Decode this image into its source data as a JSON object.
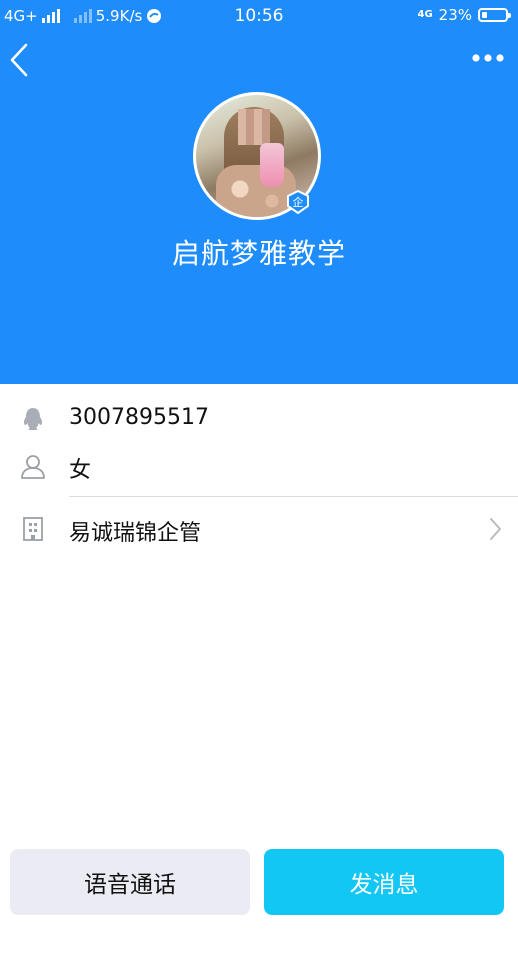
{
  "status_bar": {
    "network": "4G+",
    "speed": "5.9K/s",
    "time": "10:56",
    "network_right": "4G",
    "battery_percent_label": "23%",
    "battery_level": 0.23
  },
  "header": {
    "background_color": "#1f8cfb",
    "group_name": "启航梦雅教学",
    "badge_label": "企"
  },
  "info": {
    "qq_number": "3007895517",
    "gender": "女",
    "company": "易诚瑞锦企管"
  },
  "actions": {
    "voice_call_label": "语音通话",
    "message_label": "发消息",
    "message_color": "#13c7f5"
  },
  "icons": {
    "back": "back-arrow-icon",
    "more": "more-dots-icon",
    "qq": "penguin-icon",
    "gender": "person-icon",
    "company": "building-icon",
    "chevron": "chevron-right-icon"
  }
}
